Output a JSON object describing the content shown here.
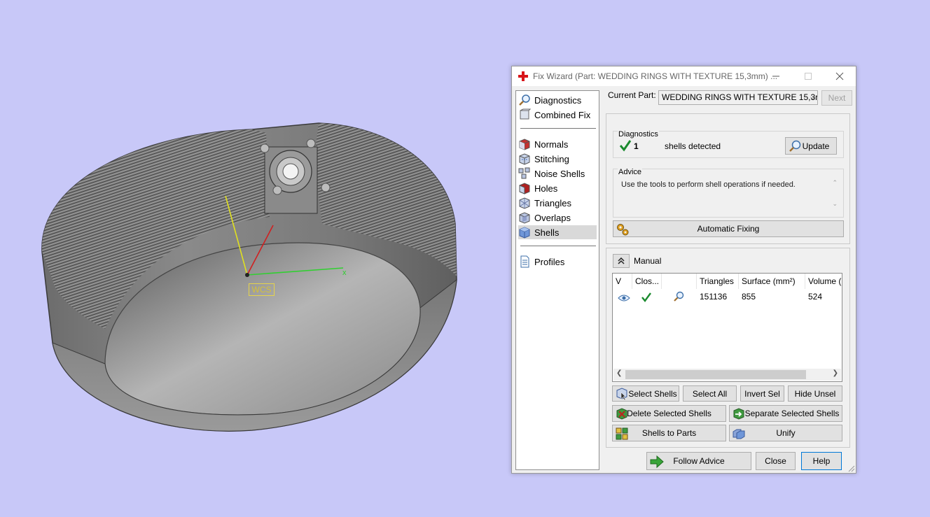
{
  "viewport": {
    "wcs_label": "WCS",
    "axis_x_label": "x",
    "background_color": "#c8c8f8"
  },
  "dialog": {
    "title": "Fix Wizard (Part: WEDDING RINGS WITH TEXTURE 15,3mm) ...",
    "nav": {
      "top_items": [
        {
          "label": "Diagnostics",
          "icon": "magnifier-icon"
        },
        {
          "label": "Combined Fix",
          "icon": "combined-fix-icon"
        }
      ],
      "fix_items": [
        {
          "label": "Normals",
          "icon": "normals-cube-icon"
        },
        {
          "label": "Stitching",
          "icon": "stitching-cube-icon"
        },
        {
          "label": "Noise Shells",
          "icon": "noise-shells-icon"
        },
        {
          "label": "Holes",
          "icon": "holes-cube-icon"
        },
        {
          "label": "Triangles",
          "icon": "triangles-icon"
        },
        {
          "label": "Overlaps",
          "icon": "overlaps-icon"
        },
        {
          "label": "Shells",
          "icon": "shells-cube-icon",
          "selected": true
        }
      ],
      "bottom_items": [
        {
          "label": "Profiles",
          "icon": "profiles-document-icon"
        }
      ]
    },
    "current_part_label": "Current Part:",
    "current_part_value": "WEDDING RINGS WITH TEXTURE 15,3r",
    "next_button": "Next",
    "diagnostics": {
      "title": "Diagnostics",
      "count": "1",
      "status_text": "shells detected",
      "update_button": "Update"
    },
    "advice": {
      "title": "Advice",
      "text": "Use the tools to perform shell operations if needed."
    },
    "automatic_fixing_button": "Automatic Fixing",
    "manual": {
      "title": "Manual",
      "table": {
        "headers": [
          "V",
          "Clos...",
          "",
          "Triangles",
          "Surface (mm²)",
          "Volume ("
        ],
        "rows": [
          {
            "triangles": "151136",
            "surface": "855",
            "volume": "524"
          }
        ]
      },
      "buttons": {
        "select_shells": "Select Shells",
        "select_all": "Select All",
        "invert_sel": "Invert Sel",
        "hide_unsel": "Hide Unsel",
        "delete_selected": "Delete Selected Shells",
        "separate_selected": "Separate Selected Shells",
        "shells_to_parts": "Shells to Parts",
        "unify": "Unify"
      }
    },
    "footer": {
      "follow_advice": "Follow Advice",
      "close": "Close",
      "help": "Help"
    }
  }
}
